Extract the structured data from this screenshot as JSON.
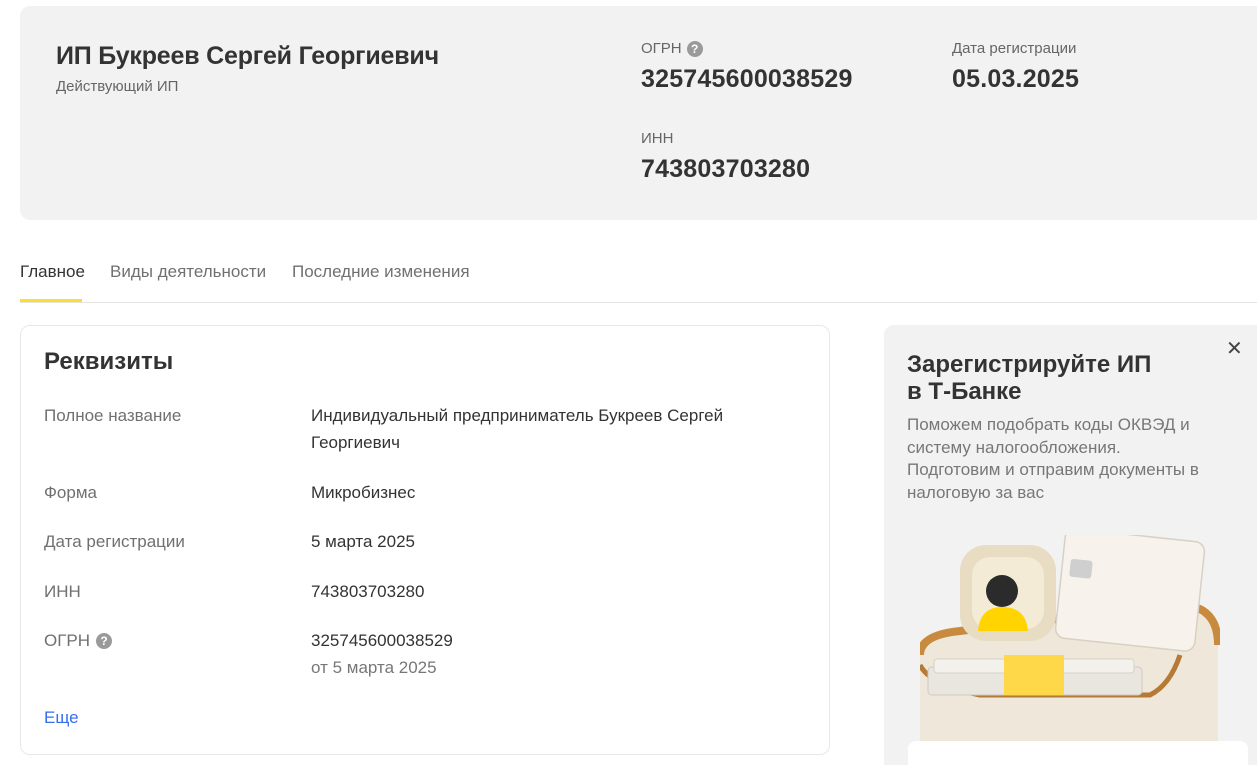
{
  "company": {
    "name": "ИП Букреев Сергей Георгиевич",
    "status": "Действующий ИП"
  },
  "summary": {
    "ogrn_label": "ОГРН",
    "ogrn_value": "325745600038529",
    "reg_date_label": "Дата регистрации",
    "reg_date_value": "05.03.2025",
    "inn_label": "ИНН",
    "inn_value": "743803703280"
  },
  "tabs": [
    {
      "label": "Главное",
      "active": true
    },
    {
      "label": "Виды деятельности",
      "active": false
    },
    {
      "label": "Последние изменения",
      "active": false
    }
  ],
  "requisites": {
    "title": "Реквизиты",
    "rows": [
      {
        "label": "Полное название",
        "value": "Индивидуальный предприниматель Букреев Сергей Георгиевич"
      },
      {
        "label": "Форма",
        "value": "Микробизнес"
      },
      {
        "label": "Дата регистрации",
        "value": "5 марта 2025"
      },
      {
        "label": "ИНН",
        "value": "743803703280"
      },
      {
        "label": "ОГРН",
        "value": "325745600038529",
        "sub": "от 5 марта 2025"
      }
    ],
    "more_label": "Еще"
  },
  "promo": {
    "title": "Зарегистрируйте ИП в Т-Банке",
    "text": "Поможем подобрать коды ОКВЭД и систему налогообложения. Подготовим и отправим документы в налоговую за вас",
    "close_glyph": "✕"
  },
  "icons": {
    "help": "?"
  },
  "colors": {
    "accent": "#ffdd2d",
    "link": "#336fee",
    "panel": "#f2f2f2"
  }
}
